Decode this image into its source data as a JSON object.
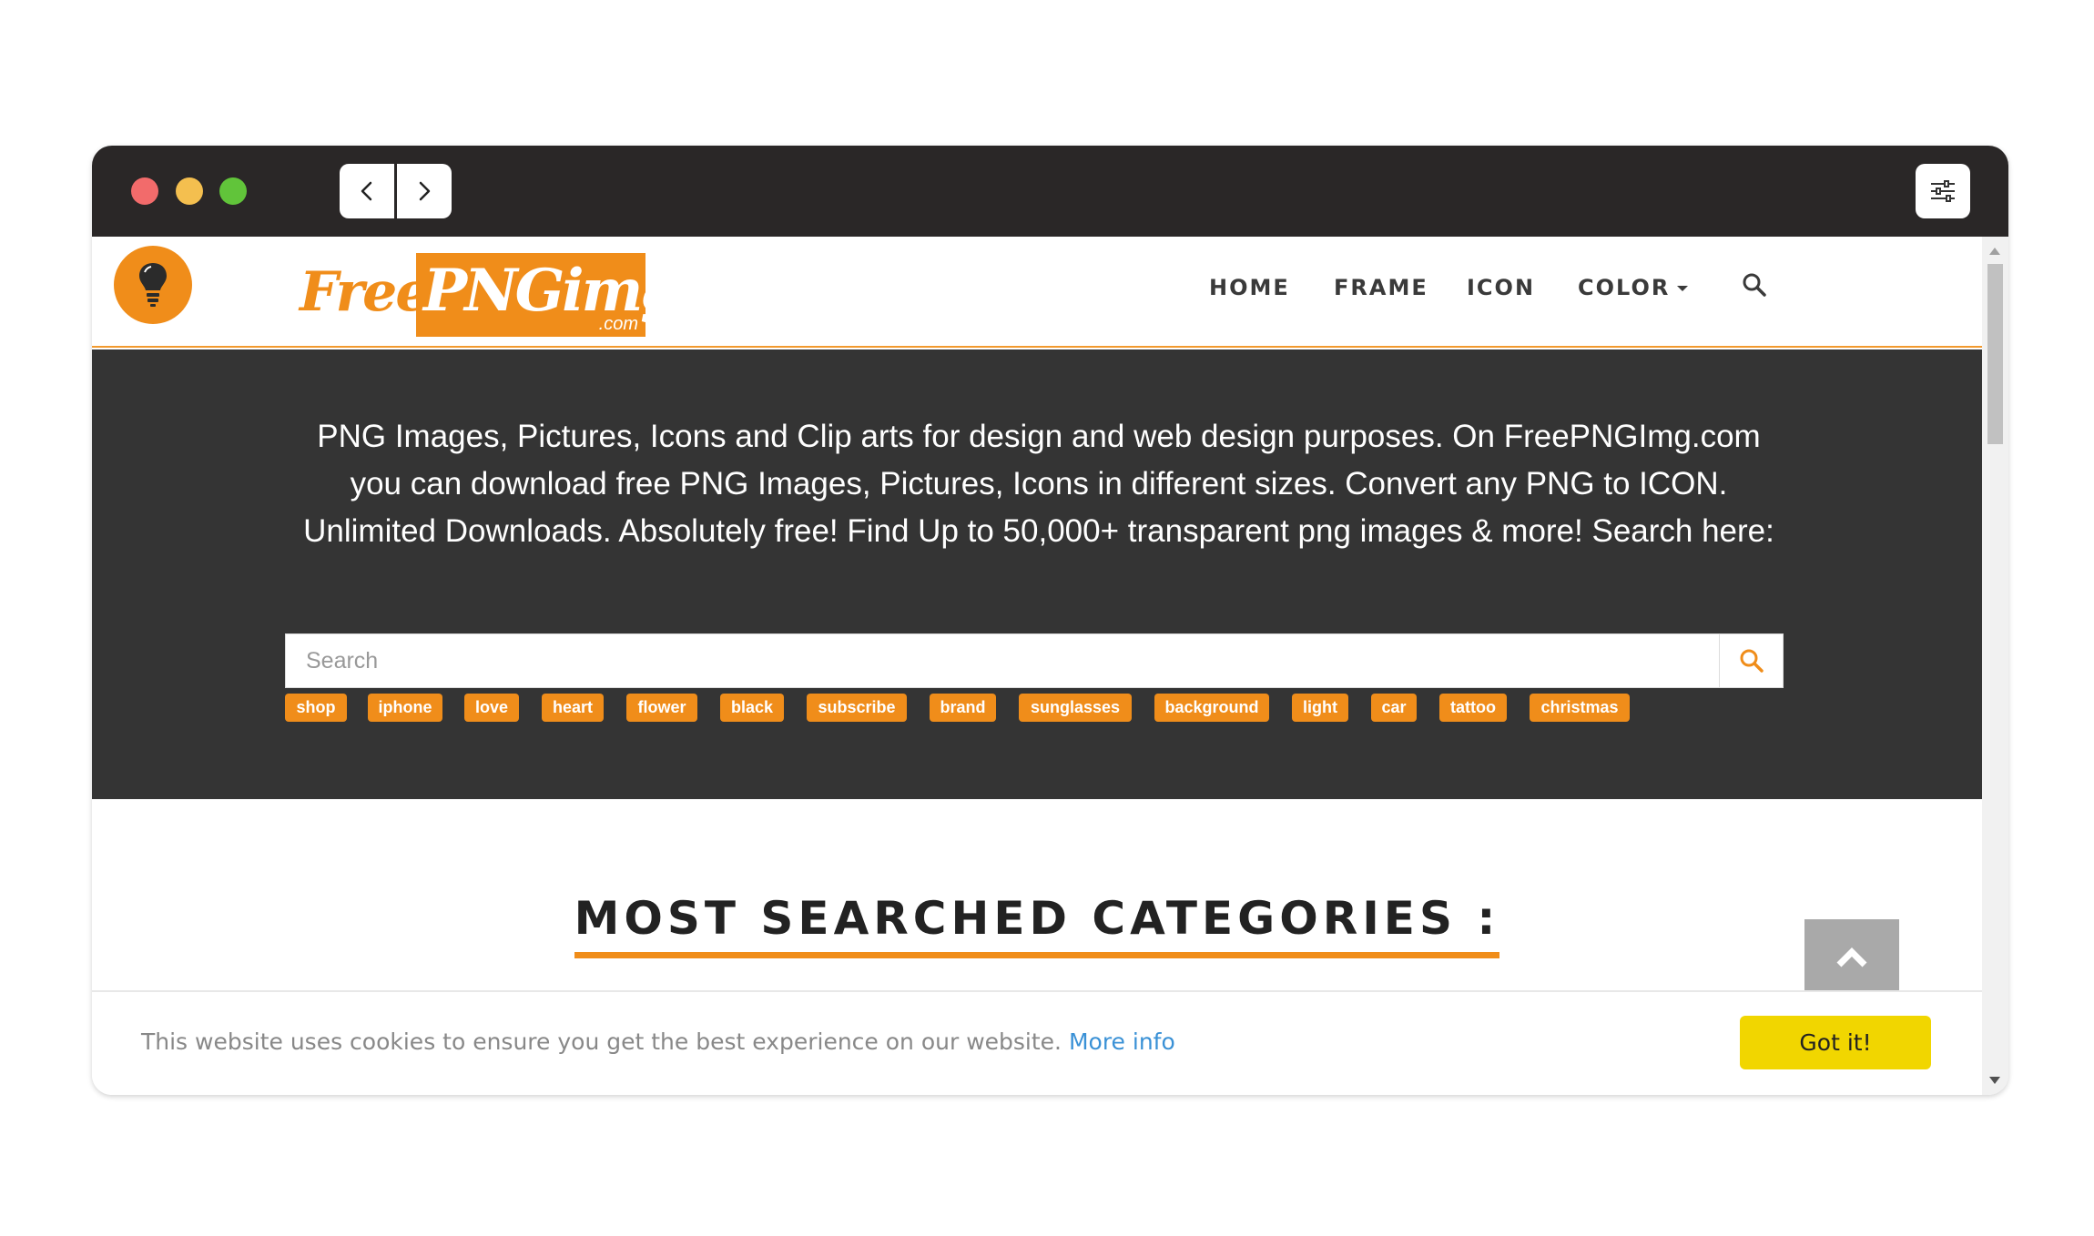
{
  "header": {
    "nav": [
      {
        "label": "HOME"
      },
      {
        "label": "FRAME"
      },
      {
        "label": "ICON"
      },
      {
        "label": "COLOR"
      }
    ]
  },
  "logo": {
    "free": "Free",
    "png": "PNGimg",
    "com": ".com"
  },
  "hero": {
    "text": "PNG Images, Pictures, Icons and Clip arts for design and web design purposes. On FreePNGImg.com you can download free PNG Images, Pictures, Icons in different sizes. Convert any PNG to ICON. Unlimited Downloads. Absolutely free! Find Up to 50,000+ transparent png images & more! Search here:",
    "search_placeholder": "Search",
    "tags": [
      "shop",
      "iphone",
      "love",
      "heart",
      "flower",
      "black",
      "subscribe",
      "brand",
      "sunglasses",
      "background",
      "light",
      "car",
      "tattoo",
      "christmas"
    ]
  },
  "categories": {
    "title": "MOST SEARCHED CATEGORIES :"
  },
  "cookie": {
    "message": "This website uses cookies to ensure you get the best experience on our website.",
    "more_info": "More info",
    "button": "Got it!"
  },
  "colors": {
    "brand_orange": "#f08d1a",
    "hero_bg": "#343434",
    "titlebar_bg": "#2a2727",
    "cookie_button": "#f1d600",
    "link_blue": "#3a91d6"
  },
  "icons": [
    "close-dot",
    "minimize-dot",
    "maximize-dot",
    "chevron-left-icon",
    "chevron-right-icon",
    "settings-sliders-icon",
    "lightbulb-icon",
    "search-icon",
    "caret-down-icon",
    "chevron-up-icon"
  ]
}
